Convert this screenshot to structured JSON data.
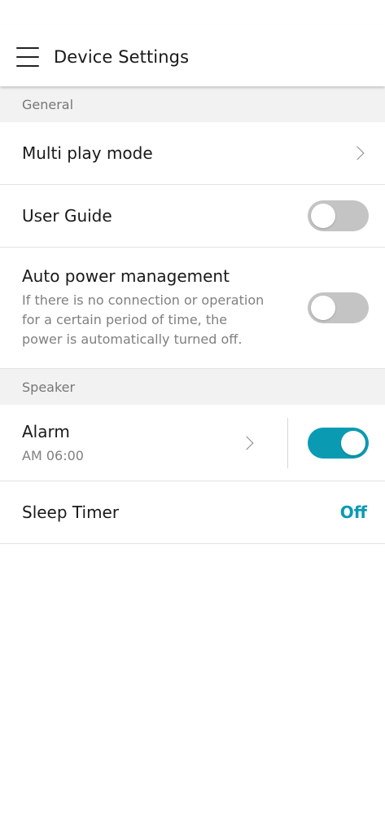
{
  "header": {
    "title": "Device Settings",
    "menu_icon": "hamburger-menu-icon"
  },
  "sections": {
    "general": {
      "label": "General",
      "multi_play": {
        "title": "Multi play mode",
        "icon": "chevron-right-icon"
      },
      "user_guide": {
        "title": "User Guide",
        "toggle_state": "off"
      },
      "auto_power": {
        "title": "Auto power management",
        "description": "If there is no connection or operation for a certain period of time, the power is automatically turned off.",
        "toggle_state": "off"
      }
    },
    "speaker": {
      "label": "Speaker",
      "alarm": {
        "title": "Alarm",
        "time": "AM 06:00",
        "toggle_state": "on",
        "icon": "chevron-right-icon"
      },
      "sleep_timer": {
        "title": "Sleep Timer",
        "value": "Off"
      }
    }
  },
  "colors": {
    "accent": "#0a9bb3",
    "toggle_off": "#c4c4c4",
    "section_bg": "#f2f2f2"
  }
}
